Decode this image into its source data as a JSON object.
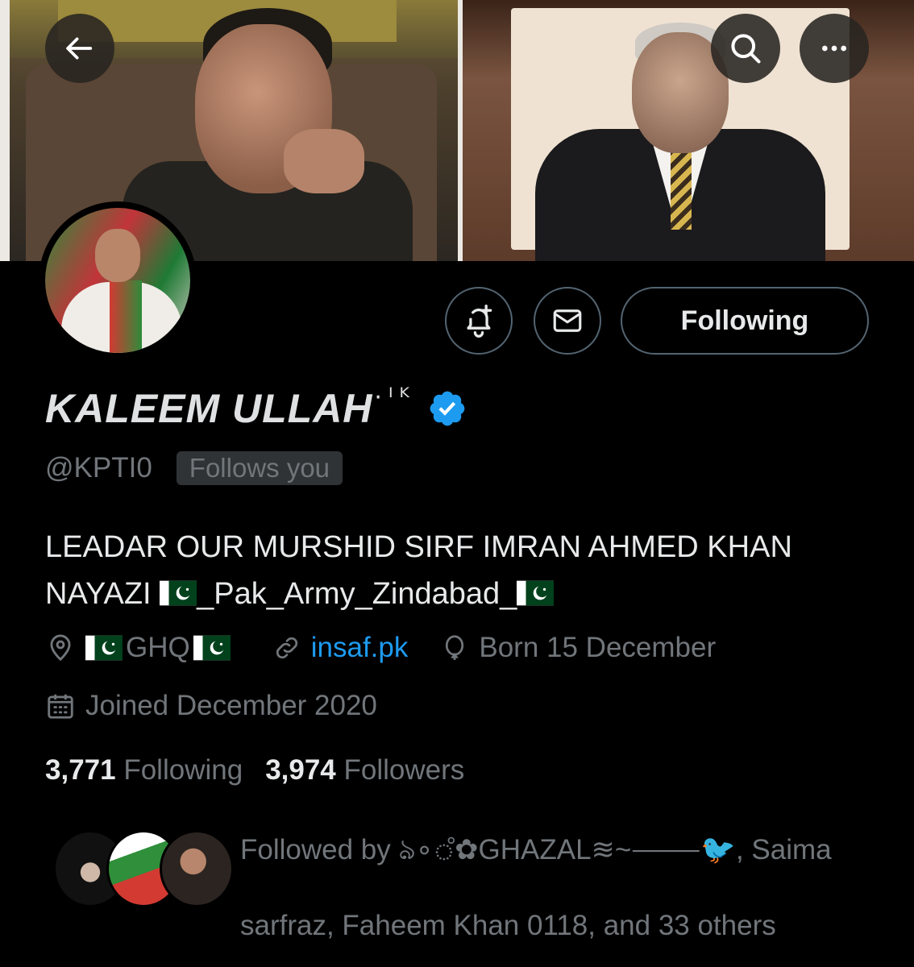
{
  "header": {
    "back_icon": "arrow-left-icon",
    "search_icon": "search-icon",
    "more_icon": "more-horizontal-icon"
  },
  "profile": {
    "display_name": "KALEEM ULLAH",
    "name_suffix": "·ᴵᴷ",
    "handle": "@KPTI0",
    "follows_you_badge": "Follows you",
    "bio_line1": "LEADAR OUR MURSHID SIRF IMRAN AHMED KHAN",
    "bio_line2_prefix": "NAYAZI",
    "bio_line2_text": "_Pak_Army_Zindabad_",
    "location": "GHQ",
    "website": "insaf.pk",
    "birthday": "Born 15 December",
    "joined": "Joined December 2020"
  },
  "actions": {
    "notify_icon": "bell-plus-icon",
    "message_icon": "mail-icon",
    "following_label": "Following"
  },
  "stats": {
    "following_count": "3,771",
    "following_label": "Following",
    "followers_count": "3,974",
    "followers_label": "Followers"
  },
  "followed_by": {
    "prefix": "Followed by",
    "name1": "ঌ∘ஂ✿GHAZAL≋~⸻🐦",
    "rest_line1": ", Saima",
    "line2": "sarfraz, Faheem Khan 0118, and 33 others"
  },
  "colors": {
    "background": "#000000",
    "text_primary": "#e7e9ea",
    "text_secondary": "#71767b",
    "link": "#1d9bf0",
    "border": "#536471",
    "verified": "#1d9bf0"
  }
}
